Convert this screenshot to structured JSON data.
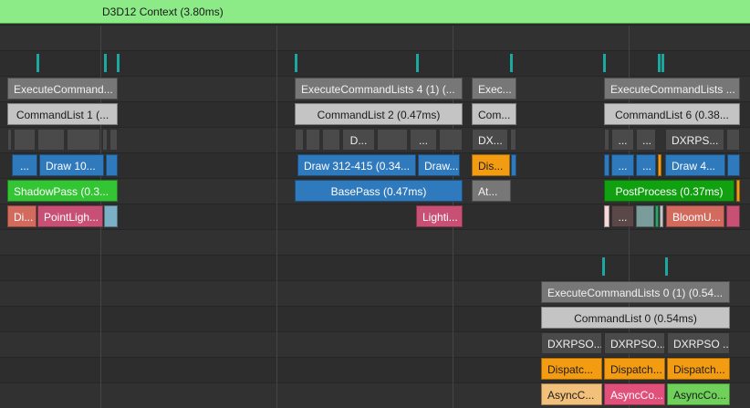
{
  "context": {
    "label": "D3D12 Context (3.80ms)"
  },
  "colors": {
    "context_bar": "#8cea87",
    "marker": "#1ba8a0",
    "background": "#313131"
  },
  "gpu_queue_main": {
    "execute_command_lists": [
      "ExecuteCommand...",
      "ExecuteCommandLists 4 (1) (...",
      "Exec...",
      "ExecuteCommandLists ..."
    ],
    "command_lists": [
      "CommandList 1 (...",
      "CommandList 2 (0.47ms)",
      "Com...",
      "CommandList 6 (0.38..."
    ],
    "pipeline_states": [
      "D...",
      "...",
      "DX...",
      "...",
      "...",
      "DXRPS..."
    ],
    "draws": [
      "...",
      "Draw 10...",
      "Draw 312-415 (0.34...",
      "Draw...",
      "Dis...",
      "...",
      "...",
      "Draw 4..."
    ],
    "passes": [
      "ShadowPass (0.3...",
      "BasePass (0.47ms)",
      "At...",
      "PostProcess (0.37ms)"
    ],
    "subpasses": [
      "Di...",
      "PointLigh...",
      "Lighti...",
      "...",
      "BloomU..."
    ]
  },
  "gpu_queue_async": {
    "execute_command_lists": [
      "ExecuteCommandLists 0 (1) (0.54..."
    ],
    "command_lists": [
      "CommandList 0 (0.54ms)"
    ],
    "pipeline_states": [
      "DXRPSO...",
      "DXRPSO...",
      "DXRPSO ..."
    ],
    "dispatches": [
      "Dispatc...",
      "Dispatch...",
      "Dispatch..."
    ],
    "async_compute": [
      "AsyncC...",
      "AsyncCo...",
      "AsyncCo..."
    ]
  }
}
